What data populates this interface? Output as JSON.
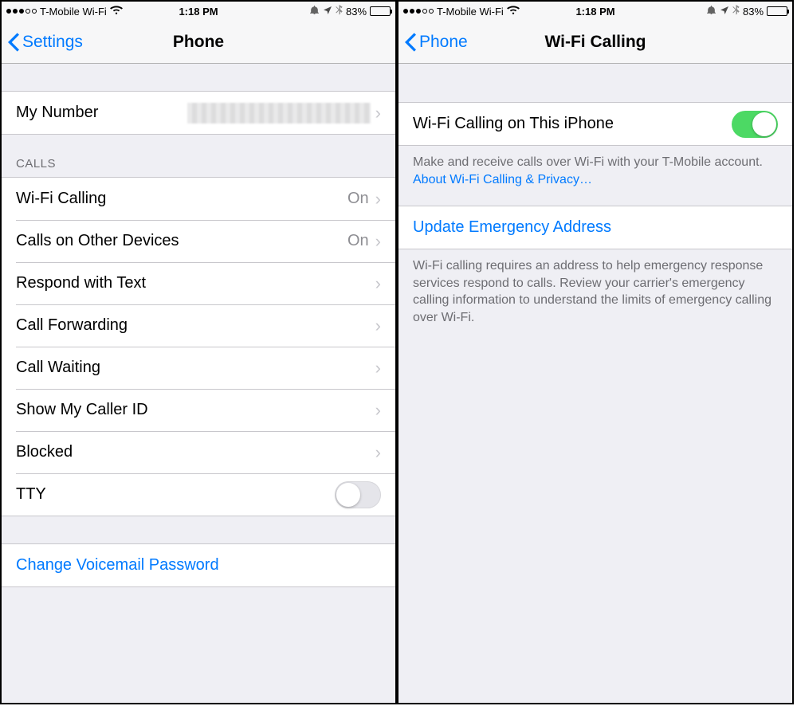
{
  "status": {
    "carrier": "T-Mobile Wi-Fi",
    "time": "1:18 PM",
    "battery_pct": "83%"
  },
  "left": {
    "back_label": "Settings",
    "title": "Phone",
    "my_number_label": "My Number",
    "calls_header": "CALLS",
    "rows": {
      "wifi_calling": {
        "label": "Wi-Fi Calling",
        "value": "On"
      },
      "other_devices": {
        "label": "Calls on Other Devices",
        "value": "On"
      },
      "respond_text": {
        "label": "Respond with Text"
      },
      "call_forwarding": {
        "label": "Call Forwarding"
      },
      "call_waiting": {
        "label": "Call Waiting"
      },
      "caller_id": {
        "label": "Show My Caller ID"
      },
      "blocked": {
        "label": "Blocked"
      },
      "tty": {
        "label": "TTY",
        "on": false
      }
    },
    "change_voicemail": "Change Voicemail Password"
  },
  "right": {
    "back_label": "Phone",
    "title": "Wi-Fi Calling",
    "toggle_label": "Wi-Fi Calling on This iPhone",
    "toggle_on": true,
    "footer1_text": "Make and receive calls over Wi-Fi with your T-Mobile account. ",
    "footer1_link": "About Wi-Fi Calling & Privacy…",
    "update_address": "Update Emergency Address",
    "footer2": "Wi-Fi calling requires an address to help emergency response services respond to calls. Review your carrier's emergency calling information to understand the limits of emergency calling over Wi-Fi."
  }
}
